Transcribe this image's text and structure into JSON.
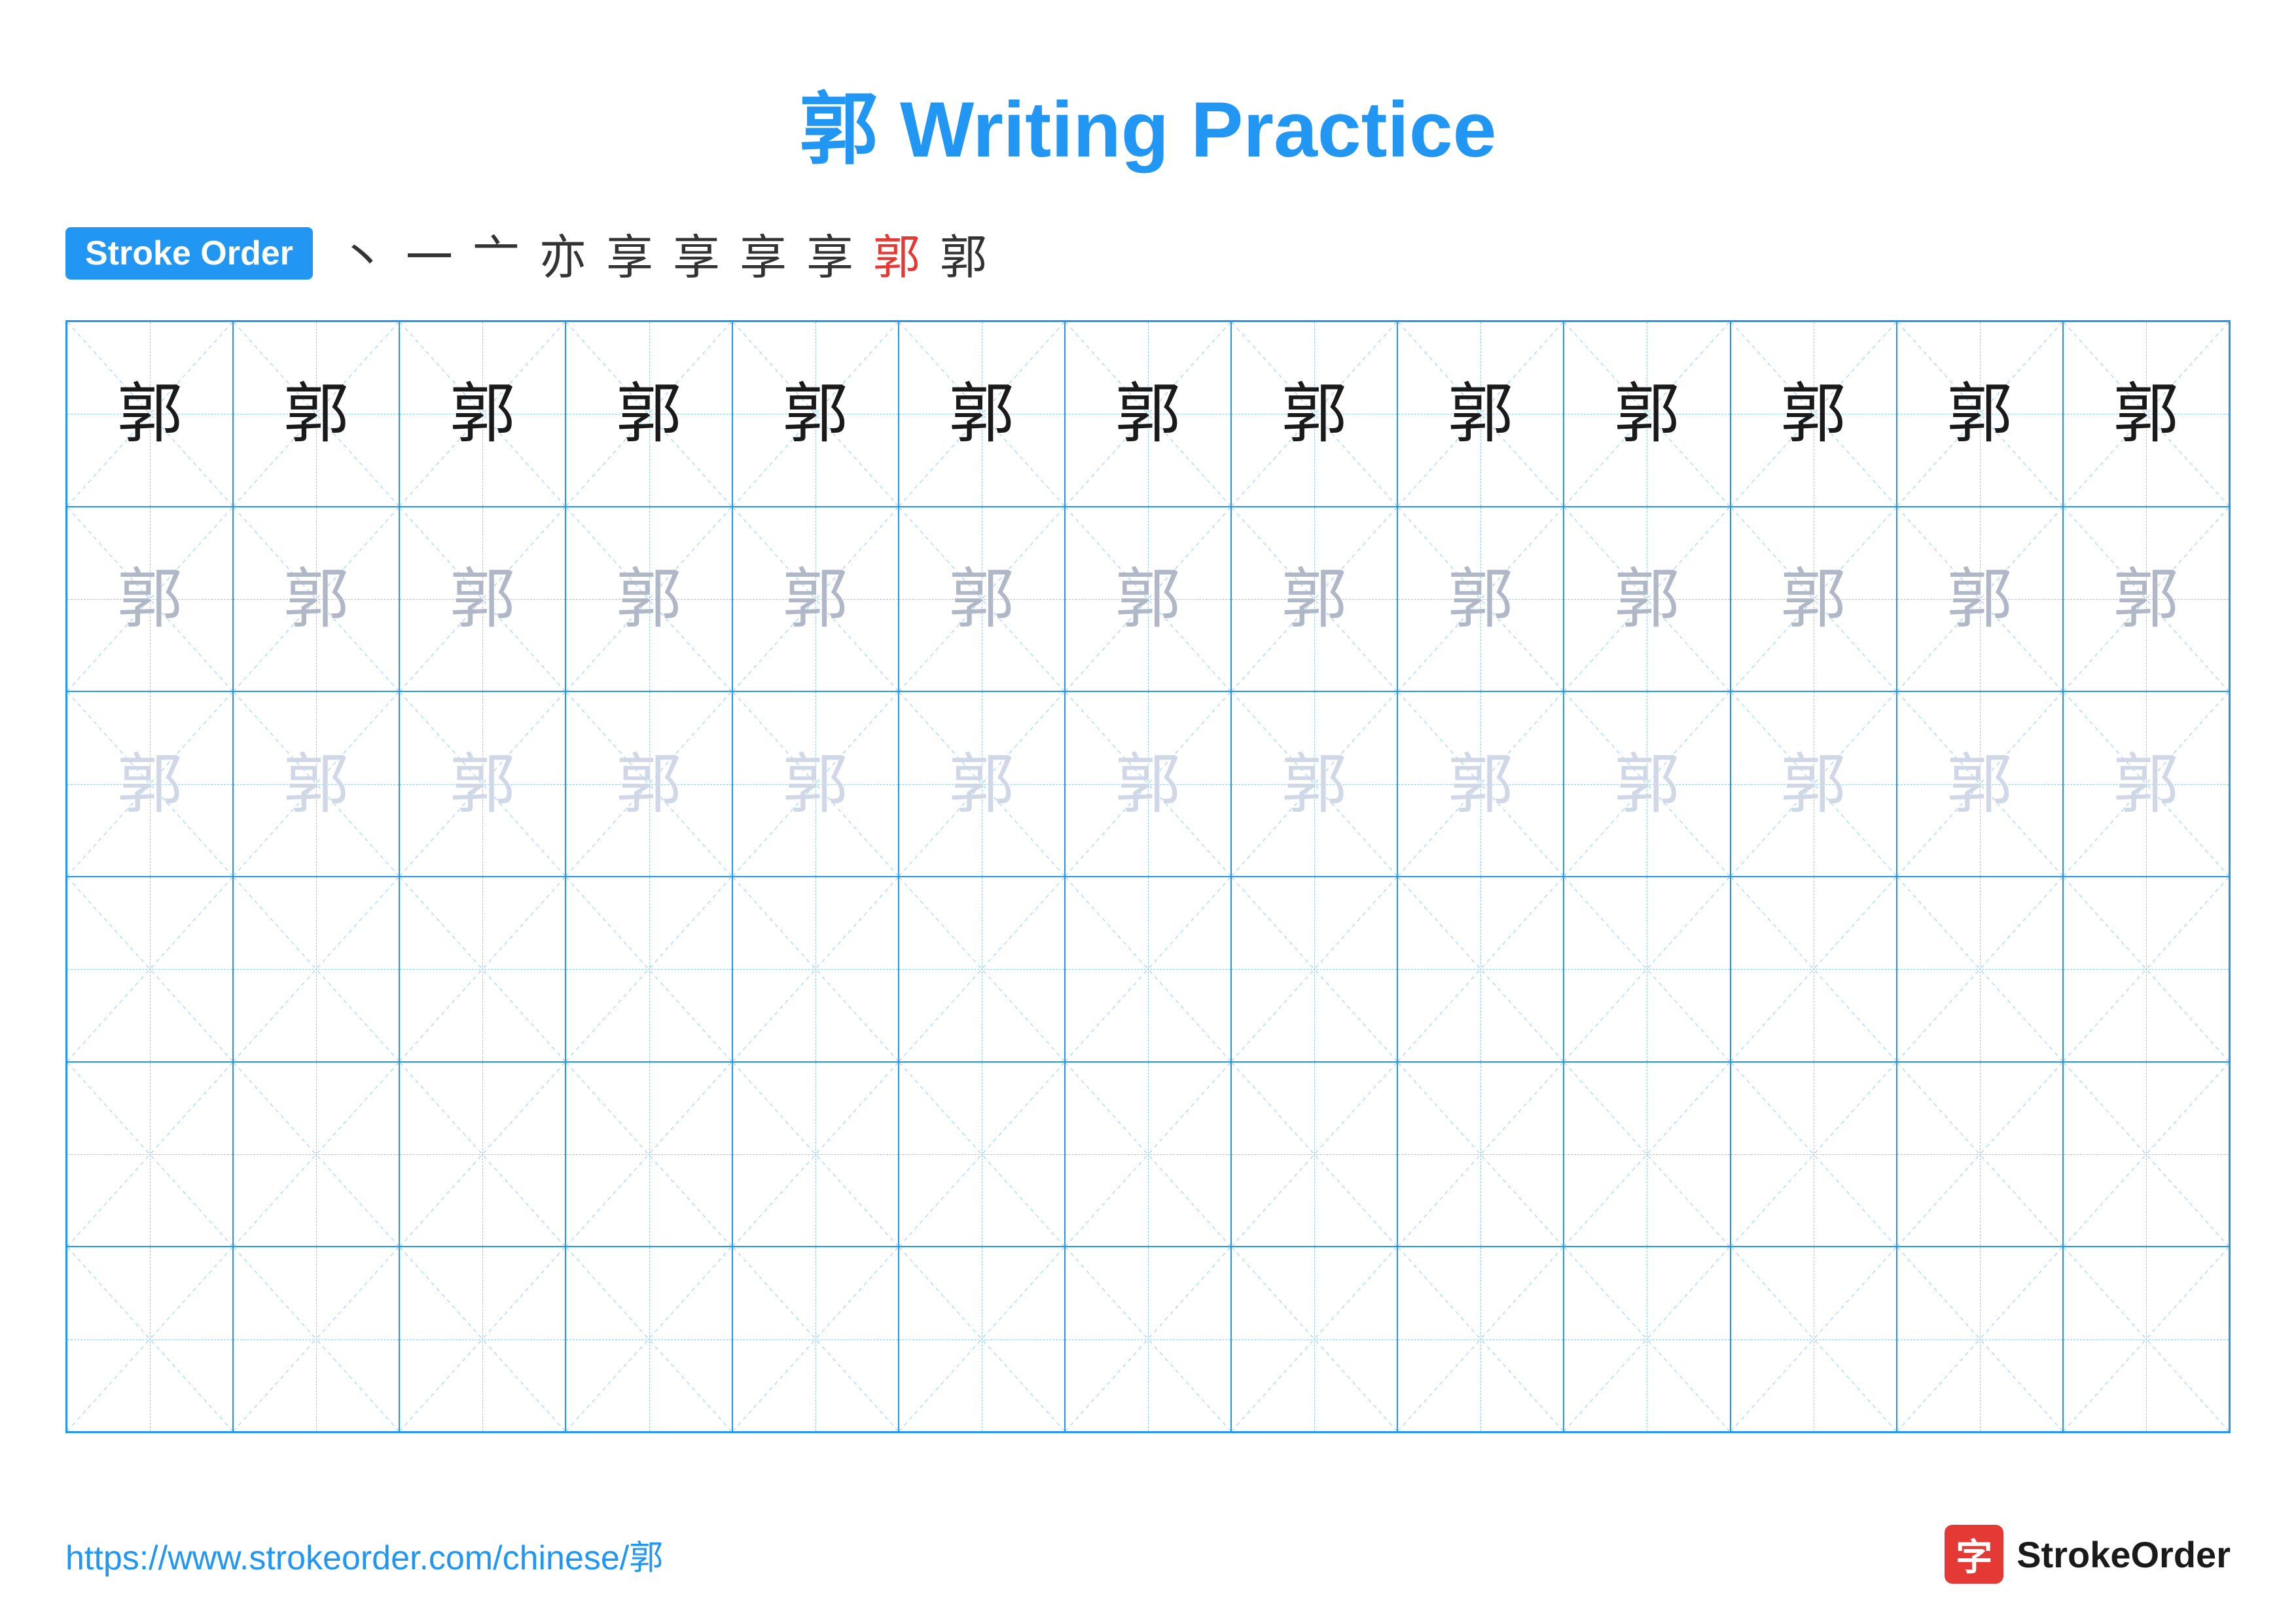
{
  "title": {
    "text": "郭 Writing Practice"
  },
  "stroke_order": {
    "badge_label": "Stroke Order",
    "sequence": [
      "丶",
      "一",
      "亠",
      "亦",
      "享",
      "享",
      "享",
      "享",
      "郭",
      "郭"
    ]
  },
  "grid": {
    "cols": 13,
    "rows": 6,
    "character": "郭",
    "row_styles": [
      "dark",
      "medium",
      "light",
      "empty",
      "empty",
      "empty"
    ]
  },
  "footer": {
    "url": "https://www.strokeorder.com/chinese/郭",
    "logo_char": "字",
    "logo_text": "StrokeOrder"
  }
}
